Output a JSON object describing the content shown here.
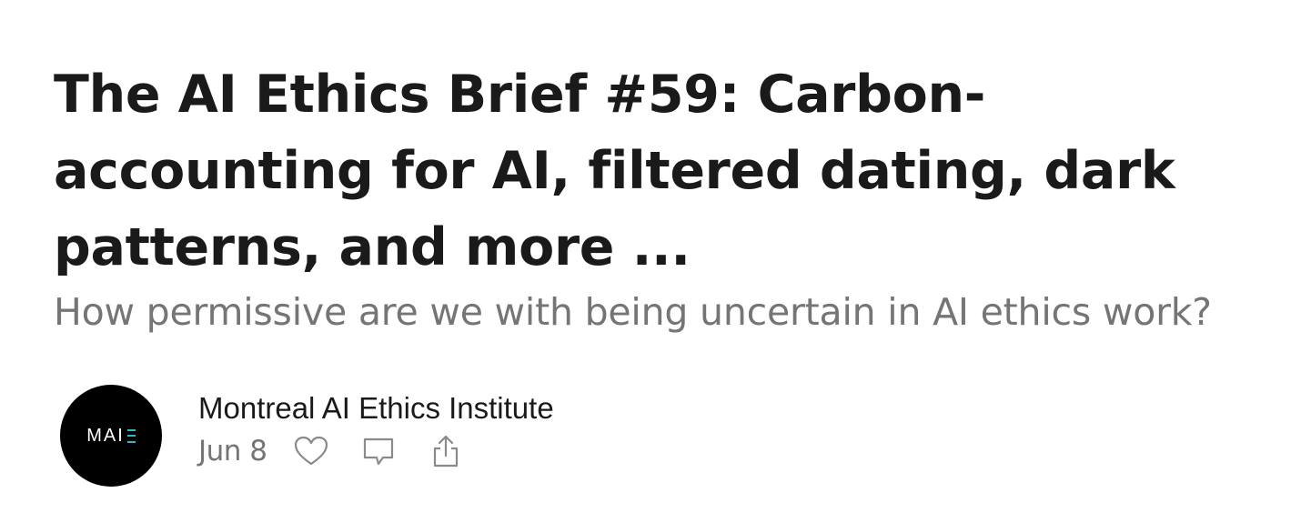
{
  "post": {
    "title": "The AI Ethics Brief #59: Carbon-accounting for AI, filtered dating, dark patterns, and more ...",
    "subtitle": "How permissive are we with being uncertain in AI ethics work?"
  },
  "byline": {
    "avatar_text": "MAI",
    "author": "Montreal AI Ethics Institute",
    "date": "Jun 8"
  },
  "icons": {
    "like": "heart-icon",
    "comment": "comment-icon",
    "share": "share-icon"
  },
  "colors": {
    "title": "#1a1a1a",
    "muted": "#757575",
    "avatar_bg": "#000000",
    "avatar_accent": "#2fb8c8"
  }
}
